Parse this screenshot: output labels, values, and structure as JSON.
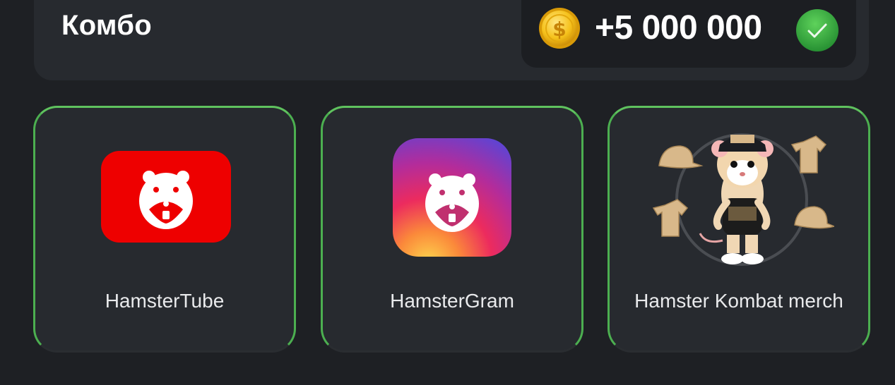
{
  "combo": {
    "title": "Комбо",
    "reward": "+5 000 000",
    "coin_icon": "gold-coin-dollar-icon",
    "status_icon": "green-check-icon"
  },
  "cards": [
    {
      "label": "HamsterTube",
      "icon": "hamstertube-logo"
    },
    {
      "label": "HamsterGram",
      "icon": "hamstergram-logo"
    },
    {
      "label": "Hamster Kombat merch",
      "icon": "hamster-merch-image"
    }
  ],
  "colors": {
    "background": "#1e2024",
    "panel": "#272a2f",
    "card_border": "#4caf50",
    "tube_red": "#ee0000",
    "check_green": "#3aa745"
  }
}
